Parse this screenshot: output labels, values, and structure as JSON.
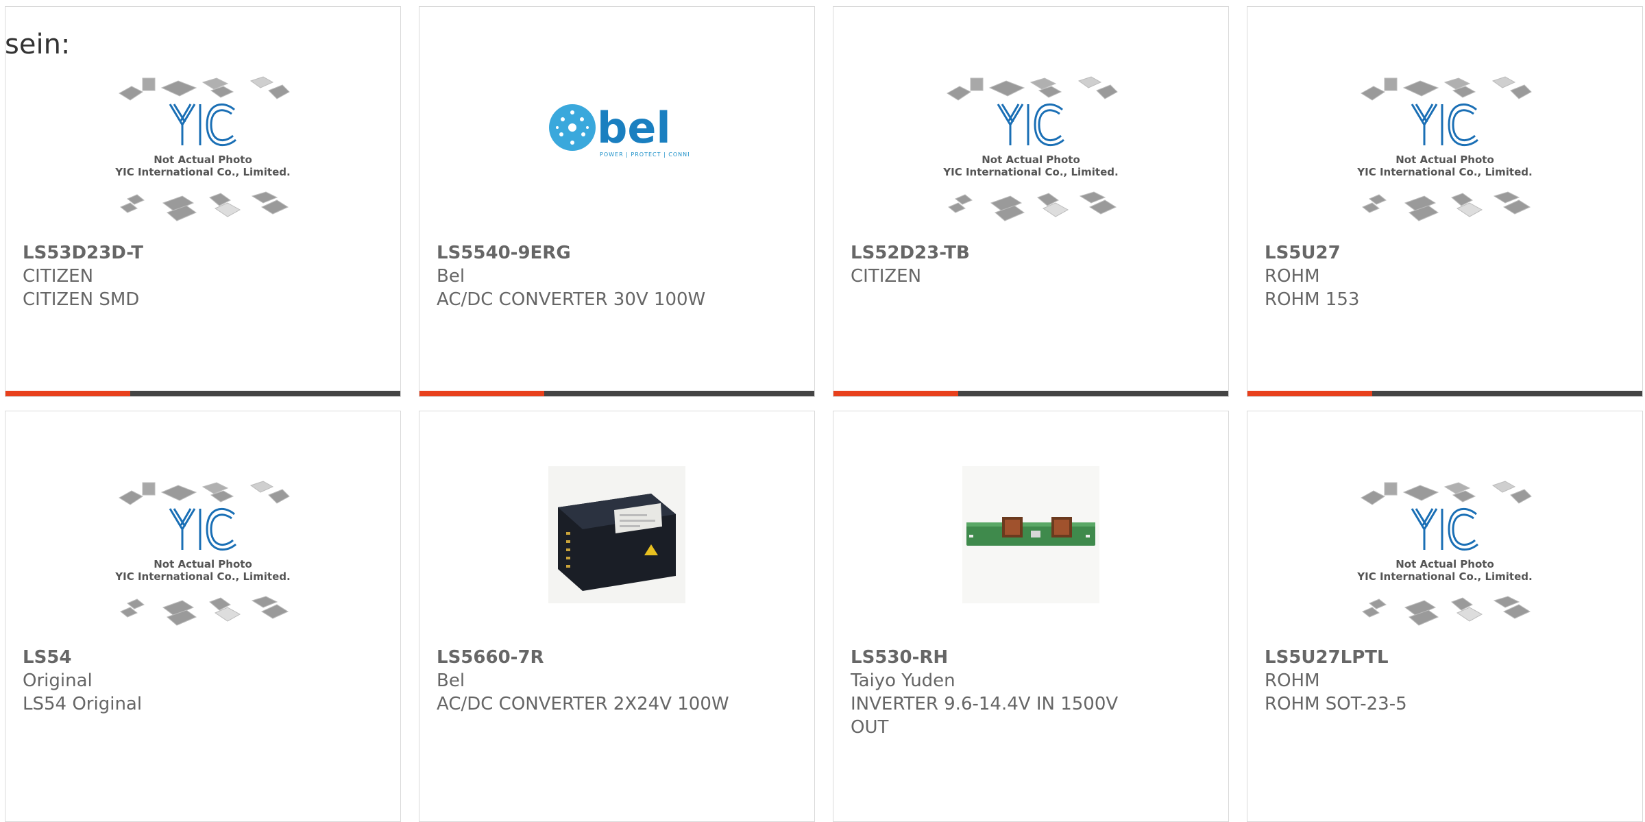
{
  "heading": "sein:",
  "products": [
    {
      "part": "LS53D23D-T",
      "brand": "CITIZEN",
      "desc": "CITIZEN SMD",
      "image": "yic-placeholder",
      "caption1": "Not Actual Photo",
      "caption2": "YIC International Co., Limited."
    },
    {
      "part": "LS5540-9ERG",
      "brand": "Bel",
      "desc": "AC/DC CONVERTER 30V 100W",
      "image": "bel-logo",
      "logo_text": "bel",
      "logo_tagline": "POWER | PROTECT | CONNECT"
    },
    {
      "part": "LS52D23-TB",
      "brand": "CITIZEN",
      "desc": "",
      "image": "yic-placeholder",
      "caption1": "Not Actual Photo",
      "caption2": "YIC International Co., Limited."
    },
    {
      "part": "LS5U27",
      "brand": "ROHM",
      "desc": "ROHM 153",
      "image": "yic-placeholder",
      "caption1": "Not Actual Photo",
      "caption2": "YIC International Co., Limited."
    },
    {
      "part": "LS54",
      "brand": "Original",
      "desc": "LS54 Original",
      "image": "yic-placeholder",
      "caption1": "Not Actual Photo",
      "caption2": "YIC International Co., Limited."
    },
    {
      "part": "LS5660-7R",
      "brand": "Bel",
      "desc": "AC/DC CONVERTER 2X24V 100W",
      "image": "converter-photo"
    },
    {
      "part": "LS530-RH",
      "brand": "Taiyo Yuden",
      "desc": "INVERTER 9.6-14.4V IN 1500V OUT",
      "image": "inverter-board-photo"
    },
    {
      "part": "LS5U27LPTL",
      "brand": "ROHM",
      "desc": "ROHM SOT-23-5",
      "image": "yic-placeholder",
      "caption1": "Not Actual Photo",
      "caption2": "YIC International Co., Limited."
    }
  ],
  "colors": {
    "accent": "#e8401c",
    "bar": "#444444",
    "text": "#666666",
    "yic_blue": "#1a6fb5",
    "bel_blue": "#1a8fc8"
  }
}
